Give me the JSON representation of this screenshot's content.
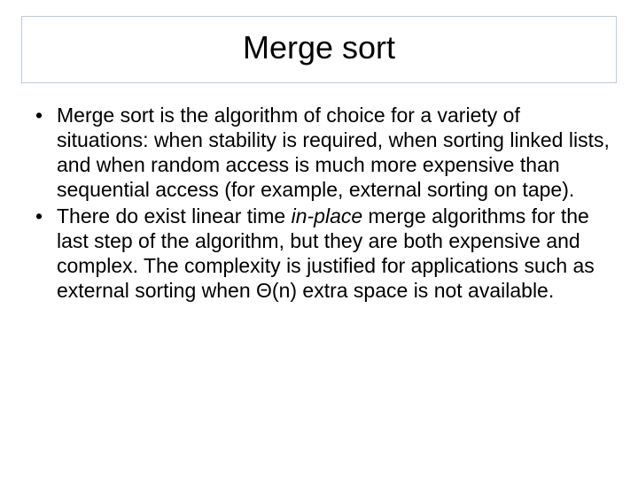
{
  "slide": {
    "title": "Merge sort",
    "bullets": [
      {
        "text_before": "Merge sort is the algorithm of choice for a variety of situations: when stability is required, when sorting linked lists, and when random access is much more expensive than sequential access (for example, external sorting on tape).",
        "italic_text": "",
        "text_after": ""
      },
      {
        "text_before": "There do exist linear time ",
        "italic_text": "in-place",
        "text_after": " merge algorithms for the last step of the algorithm, but they are both expensive and complex. The complexity is justified for applications such as external sorting when Θ(n) extra space is not available."
      }
    ]
  }
}
